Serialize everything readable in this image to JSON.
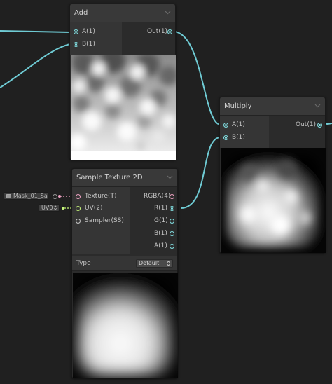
{
  "nodes": {
    "add": {
      "title": "Add",
      "inputs": [
        "A(1)",
        "B(1)"
      ],
      "outputs": [
        "Out(1)"
      ]
    },
    "multiply": {
      "title": "Multiply",
      "inputs": [
        "A(1)",
        "B(1)"
      ],
      "outputs": [
        "Out(1)"
      ]
    },
    "sample_texture": {
      "title": "Sample Texture 2D",
      "inputs": [
        "Texture(T)",
        "UV(2)",
        "Sampler(SS)"
      ],
      "outputs": [
        "RGBA(4)",
        "R(1)",
        "G(1)",
        "B(1)",
        "A(1)"
      ],
      "type_label": "Type",
      "type_value": "Default"
    }
  },
  "external": {
    "texture_field": "Mask_01_Sa",
    "uv_field": "UV0"
  },
  "icons": {
    "collapse": "chevron-down-icon",
    "texture": "texture-icon",
    "dropdown": "dropdown-arrow-icon"
  },
  "colors": {
    "background": "#202020",
    "node_body": "#2b2b2b",
    "node_header": "#393939",
    "wire": "#6fcbd4",
    "port_float": "#84e4e7",
    "port_texture": "#f1a3c4",
    "port_uv": "#c6f57a"
  }
}
